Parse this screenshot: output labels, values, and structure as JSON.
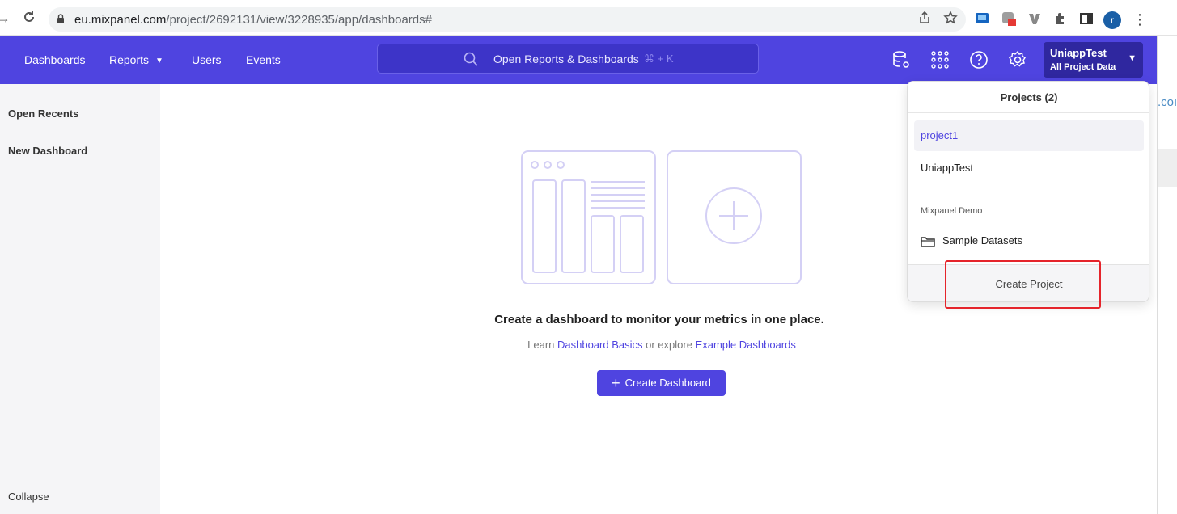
{
  "browser": {
    "url_host": "eu.mixpanel.com",
    "url_path": "/project/2692131/view/3228935/app/dashboards#",
    "profile_initial": "r"
  },
  "navbar": {
    "items": [
      {
        "label": "Dashboards"
      },
      {
        "label": "Reports"
      },
      {
        "label": "Users"
      },
      {
        "label": "Events"
      }
    ],
    "search_placeholder": "Open Reports & Dashboards",
    "search_shortcut": "⌘ + K",
    "project_name": "UniappTest",
    "project_scope": "All Project Data",
    "accent_color": "#4f44e0"
  },
  "sidebar": {
    "items": [
      {
        "label": "Open Recents"
      },
      {
        "label": "New Dashboard"
      }
    ],
    "collapse_label": "Collapse"
  },
  "empty_state": {
    "title": "Create a dashboard to monitor your metrics in one place.",
    "sub_prefix": "Learn",
    "link1": "Dashboard Basics",
    "sub_middle": "or explore",
    "link2": "Example Dashboards",
    "button_label": "Create Dashboard"
  },
  "project_dropdown": {
    "header": "Projects (2)",
    "projects": [
      {
        "label": "project1",
        "active": true
      },
      {
        "label": "UniappTest",
        "active": false
      }
    ],
    "group_label": "Mixpanel Demo",
    "sample_label": "Sample Datasets",
    "create_label": "Create Project"
  },
  "right_strip": {
    "fragment": ".coı"
  }
}
